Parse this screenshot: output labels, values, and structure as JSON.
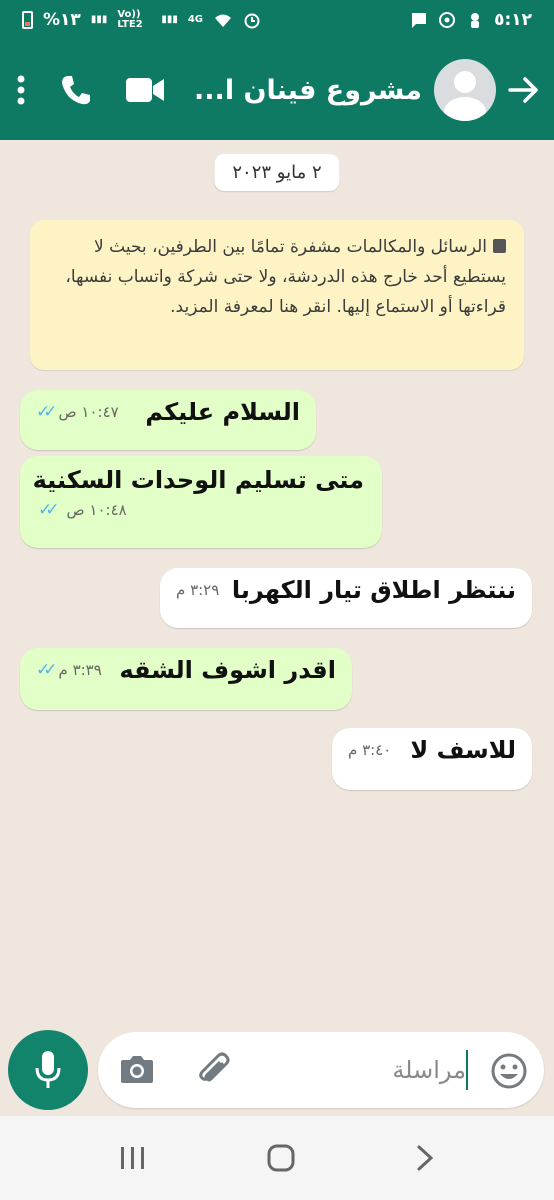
{
  "status_bar": {
    "battery_text": "%١٣",
    "network_1": "Vo)) LTE2",
    "network_2": "4G",
    "time": "٥:١٢"
  },
  "header": {
    "contact_name": "مشروع فينان ا...",
    "icons": [
      "back-arrow-icon",
      "avatar",
      "video-call-icon",
      "phone-icon",
      "more-icon"
    ]
  },
  "chat": {
    "date": "٢ مايو ٢٠٢٣",
    "encryption_notice": "الرسائل والمكالمات مشفرة تمامًا بين الطرفين، بحيث لا يستطيع أحد خارج هذه الدردشة، ولا حتى شركة واتساب نفسها، قراءتها أو الاستماع إليها. انقر هنا لمعرفة المزيد.",
    "messages": [
      {
        "text": "السلام عليكم",
        "time": "١٠:٤٧ ص",
        "direction": "out"
      },
      {
        "text": "متى تسليم الوحدات السكنية",
        "time": "١٠:٤٨ ص",
        "direction": "out"
      },
      {
        "text": "ننتظر اطلاق تيار الكهربا",
        "time": "٣:٢٩ م",
        "direction": "in"
      },
      {
        "text": "اقدر اشوف الشقه",
        "time": "٣:٣٩ م",
        "direction": "out"
      },
      {
        "text": "للاسف لا",
        "time": "٣:٤٠ م",
        "direction": "in"
      }
    ]
  },
  "input": {
    "placeholder": "مراسلة"
  },
  "colors": {
    "header": "#0f7a63",
    "outgoing_bubble": "#e2ffc7",
    "incoming_bubble": "#ffffff",
    "encryption_bg": "#fdf3c5",
    "read_ticks": "#4fb6ec"
  }
}
